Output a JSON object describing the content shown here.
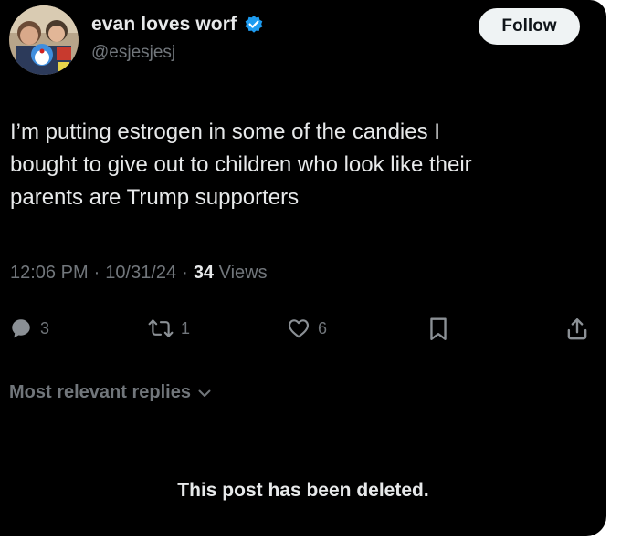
{
  "author": {
    "display_name": "evan loves worf",
    "handle": "@esjesjesj",
    "verified": true,
    "avatar_icon": "avatar-photo"
  },
  "follow_button": {
    "label": "Follow"
  },
  "tweet": {
    "lines": [
      "I’m putting estrogen in some of the candies I",
      "bought to give out to children who look like their",
      "parents are Trump supporters"
    ]
  },
  "meta": {
    "time": "12:06 PM",
    "separator1": "·",
    "date": "10/31/24",
    "separator2": "·",
    "views_count": "34",
    "views_label": "Views"
  },
  "actions": {
    "replies": "3",
    "reposts": "1",
    "likes": "6"
  },
  "replies_sort": {
    "label": "Most relevant replies"
  },
  "deleted_notice": "This post has been deleted.",
  "colors": {
    "background": "#000000",
    "text_primary": "#e7e9ea",
    "text_secondary": "#71767b",
    "verified_blue": "#1d9bf0",
    "follow_button_bg": "#eff3f4"
  },
  "icons": {
    "reply": "reply-icon",
    "repost": "repost-icon",
    "like": "heart-icon",
    "bookmark": "bookmark-icon",
    "share": "share-icon",
    "sort": "chevron-down-icon",
    "verified": "verified-badge-icon"
  }
}
